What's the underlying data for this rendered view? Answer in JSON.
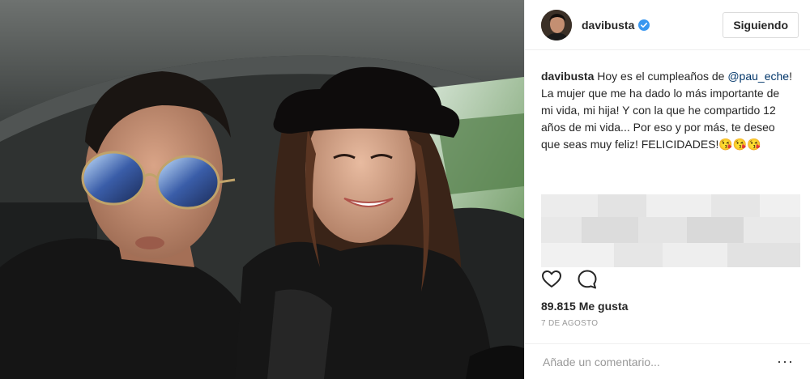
{
  "post": {
    "username": "davibusta",
    "follow_label": "Siguiendo",
    "caption": {
      "username": "davibusta",
      "text_before": " Hoy es el cumpleaños de ",
      "mention": "@pau_eche",
      "text_after": "! La mujer que me ha dado lo más importante de mi vida, mi hija! Y con la que he compartido 12 años de mi vida... Por eso y por más, te deseo que seas muy feliz! FELICIDADES!😘😘😘"
    },
    "likes": "89.815 Me gusta",
    "date": "7 DE AGOSTO",
    "comment_placeholder": "Añade un comentario...",
    "more": "···"
  },
  "icons": {
    "verified": "verified-badge-icon",
    "like": "heart-icon",
    "comment": "comment-bubble-icon",
    "more": "more-options-icon"
  },
  "colors": {
    "verified": "#3897f0",
    "mention": "#003569",
    "muted": "#999999",
    "border": "#efefef"
  }
}
